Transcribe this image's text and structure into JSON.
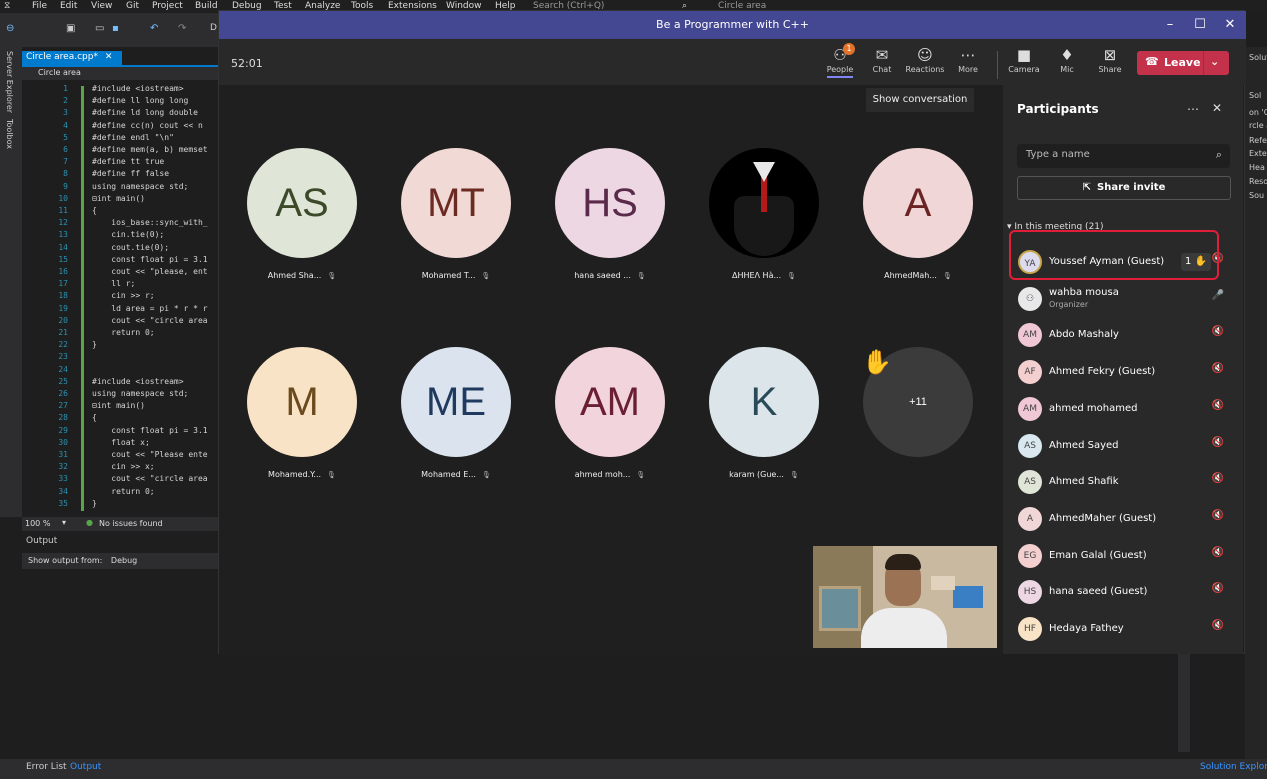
{
  "vs": {
    "menu": [
      "File",
      "Edit",
      "View",
      "Git",
      "Project",
      "Build",
      "Debug",
      "Test",
      "Analyze",
      "Tools",
      "Extensions",
      "Window",
      "Help"
    ],
    "search_placeholder": "Search (Ctrl+Q)",
    "window_title": "Circle area",
    "toolbar_extra": "D",
    "side_tabs": [
      "Server Explorer",
      "Toolbox"
    ],
    "doc_tab": "Circle area.cpp*",
    "nav_label": "Circle area",
    "line_numbers": [
      "1",
      "2",
      "3",
      "4",
      "5",
      "6",
      "7",
      "8",
      "9",
      "10",
      "11",
      "12",
      "13",
      "14",
      "15",
      "16",
      "17",
      "18",
      "19",
      "20",
      "21",
      "22",
      "23",
      "24",
      "25",
      "26",
      "27",
      "28",
      "29",
      "30",
      "31",
      "32",
      "33",
      "34",
      "35"
    ],
    "code_lines": [
      "#include <iostream>",
      "#define ll long long",
      "#define ld long double",
      "#define cc(n) cout << n",
      "#define endl \"\\n\"",
      "#define mem(a, b) memset",
      "#define tt true",
      "#define ff false",
      "using namespace std;",
      "⊟int main()",
      "{",
      "    ios_base::sync_with_",
      "    cin.tie(0);",
      "    cout.tie(0);",
      "    const float pi = 3.1",
      "    cout << \"please, ent",
      "    ll r;",
      "    cin >> r;",
      "    ld area = pi * r * r",
      "    cout << \"circle area",
      "    return 0;",
      "}",
      "",
      "",
      "#include <iostream>",
      "using namespace std;",
      "⊟int main()",
      "{",
      "    const float pi = 3.1",
      "    float x;",
      "    cout << \"Please ente",
      "    cin >> x;",
      "    cout << \"circle area",
      "    return 0;",
      "}"
    ],
    "zoom": "100 %",
    "issues": "No issues found",
    "output_title": "Output",
    "output_from_label": "Show output from:",
    "output_from_value": "Debug",
    "bottom_tabs": [
      "Error List",
      "Output"
    ],
    "right_panel_items": [
      "Solution",
      "Sol",
      "on 'C",
      "rcle a",
      "Refe",
      "Exte",
      "Hea",
      "Reso",
      "Sou"
    ],
    "solution_explorer": "Solution Explorer"
  },
  "teams": {
    "title": "Be a Programmer with C++",
    "timer": "52:01",
    "toolbar": [
      {
        "label": "People",
        "badge": "1"
      },
      {
        "label": "Chat"
      },
      {
        "label": "Reactions"
      },
      {
        "label": "More"
      },
      {
        "label": "Camera"
      },
      {
        "label": "Mic"
      },
      {
        "label": "Share"
      }
    ],
    "leave_label": "Leave",
    "tooltip": "Show conversation",
    "tiles": [
      {
        "initials": "AS",
        "name": "Ahmed Sha...",
        "bg": "#dfe6d8",
        "fg": "#3d4a2a"
      },
      {
        "initials": "MT",
        "name": "Mohamed T...",
        "bg": "#f1d9d5",
        "fg": "#6b2a22"
      },
      {
        "initials": "HS",
        "name": "hana saeed ...",
        "bg": "#ecd7e3",
        "fg": "#5a2a4a"
      },
      {
        "initials": "",
        "name": "ΔΗΗΕΛ Ηà...",
        "bg": "#000000",
        "fg": "#fff"
      },
      {
        "initials": "A",
        "name": "AhmedMah...",
        "bg": "#f0d6d6",
        "fg": "#6b2424"
      },
      {
        "initials": "M",
        "name": "Mohamed.Y...",
        "bg": "#f9e3c6",
        "fg": "#6b4a1e"
      },
      {
        "initials": "ME",
        "name": "Mohamed E...",
        "bg": "#dbe3ef",
        "fg": "#1f3a5e"
      },
      {
        "initials": "AM",
        "name": "ahmed moh...",
        "bg": "#f1d4dc",
        "fg": "#6b1f32"
      },
      {
        "initials": "K",
        "name": "karam (Gue...",
        "bg": "#dbe5ea",
        "fg": "#2a4a5a"
      },
      {
        "initials": "+11",
        "name": "",
        "bg": "#3b3b3b",
        "fg": "#fff"
      }
    ],
    "hand_emoji": "✋",
    "panel": {
      "title": "Participants",
      "search_placeholder": "Type a name",
      "share_invite": "Share invite",
      "section": "In this meeting (21)",
      "participants": [
        {
          "initials": "YA",
          "name": "Youssef Ayman (Guest)",
          "bg": "#dcdcee",
          "hand": "1 ✋"
        },
        {
          "initials": "",
          "name": "wahba mousa",
          "sub": "Organizer",
          "bg": "#e8e8e8",
          "mic_on": true
        },
        {
          "initials": "AM",
          "name": "Abdo Mashaly",
          "bg": "#f0c7d4"
        },
        {
          "initials": "AF",
          "name": "Ahmed Fekry (Guest)",
          "bg": "#f4cfd0"
        },
        {
          "initials": "AM",
          "name": "ahmed mohamed",
          "bg": "#f0c7d4"
        },
        {
          "initials": "AS",
          "name": "Ahmed Sayed",
          "bg": "#d8e8ee"
        },
        {
          "initials": "AS",
          "name": "Ahmed Shafik",
          "bg": "#dfe6d8"
        },
        {
          "initials": "A",
          "name": "AhmedMaher (Guest)",
          "bg": "#f0d6d6"
        },
        {
          "initials": "EG",
          "name": "Eman Galal (Guest)",
          "bg": "#f4cfd0"
        },
        {
          "initials": "HS",
          "name": "hana saeed (Guest)",
          "bg": "#ecd7e3"
        },
        {
          "initials": "HF",
          "name": "Hedaya Fathey",
          "bg": "#f9e3c6"
        }
      ]
    }
  }
}
